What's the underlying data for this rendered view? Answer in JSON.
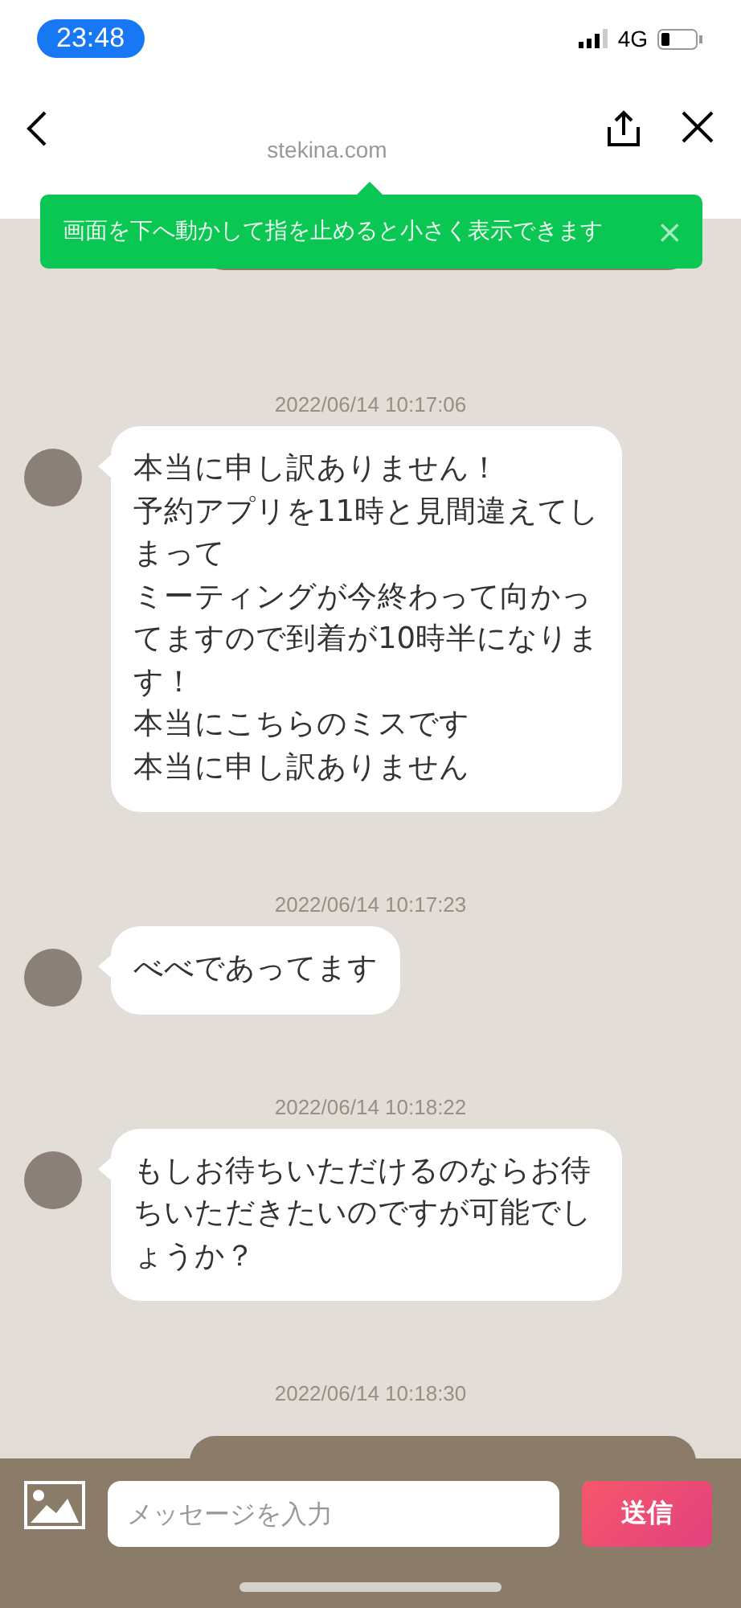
{
  "status_bar": {
    "time": "23:48",
    "network": "4G"
  },
  "browser_bar": {
    "domain": "stekina.com"
  },
  "toast": {
    "text": "画面を下へ動かして指を止めると小さく表示できます",
    "close": "×"
  },
  "messages": [
    {
      "timestamp": "2022/06/14 10:17:06",
      "lines": [
        "本当に申し訳ありません！",
        "予約アプリを11時と見間違えてしまって",
        "ミーティングが今終わって向かってますので到着が10時半になります！",
        "本当にこちらのミスです",
        "本当に申し訳ありません"
      ]
    },
    {
      "timestamp": "2022/06/14 10:17:23",
      "lines": [
        "べべであってます"
      ]
    },
    {
      "timestamp": "2022/06/14 10:18:22",
      "lines": [
        "もしお待ちいただけるのならお待ちいただきたいのですが可能でしょうか？"
      ]
    },
    {
      "timestamp": "2022/06/14 10:18:30"
    }
  ],
  "composer": {
    "placeholder": "メッセージを入力",
    "send": "送信"
  }
}
